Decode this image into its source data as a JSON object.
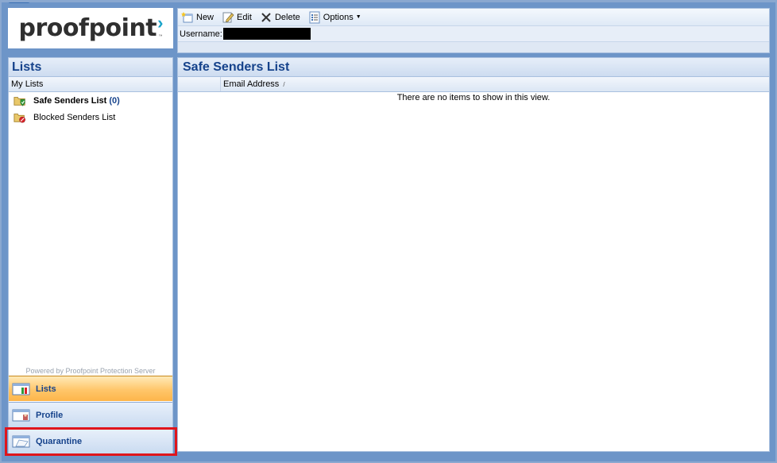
{
  "brand": {
    "logo_text": "proofpoint",
    "logo_mark": "›",
    "tm": "™"
  },
  "toolbar": {
    "new_label": "New",
    "edit_label": "Edit",
    "delete_label": "Delete",
    "options_label": "Options",
    "username_label": "Username:"
  },
  "sidebar": {
    "title": "Lists",
    "section_label": "My Lists",
    "items": [
      {
        "label": "Safe Senders List",
        "count": "(0)",
        "icon": "shield-check-folder-icon"
      },
      {
        "label": "Blocked Senders List",
        "icon": "blocked-folder-icon"
      }
    ],
    "powered_by": "Powered by Proofpoint Protection Server",
    "nav": [
      {
        "label": "Lists",
        "icon": "lists-nav-icon"
      },
      {
        "label": "Profile",
        "icon": "profile-nav-icon"
      },
      {
        "label": "Quarantine",
        "icon": "quarantine-nav-icon"
      }
    ]
  },
  "main": {
    "title": "Safe Senders List",
    "columns": [
      "",
      "Email Address"
    ],
    "empty_message": "There are no items to show in this view."
  },
  "colors": {
    "accent": "#15428b",
    "active_nav": "#ffc66a",
    "highlight": "#e0151c",
    "frame": "#6d95c8"
  }
}
